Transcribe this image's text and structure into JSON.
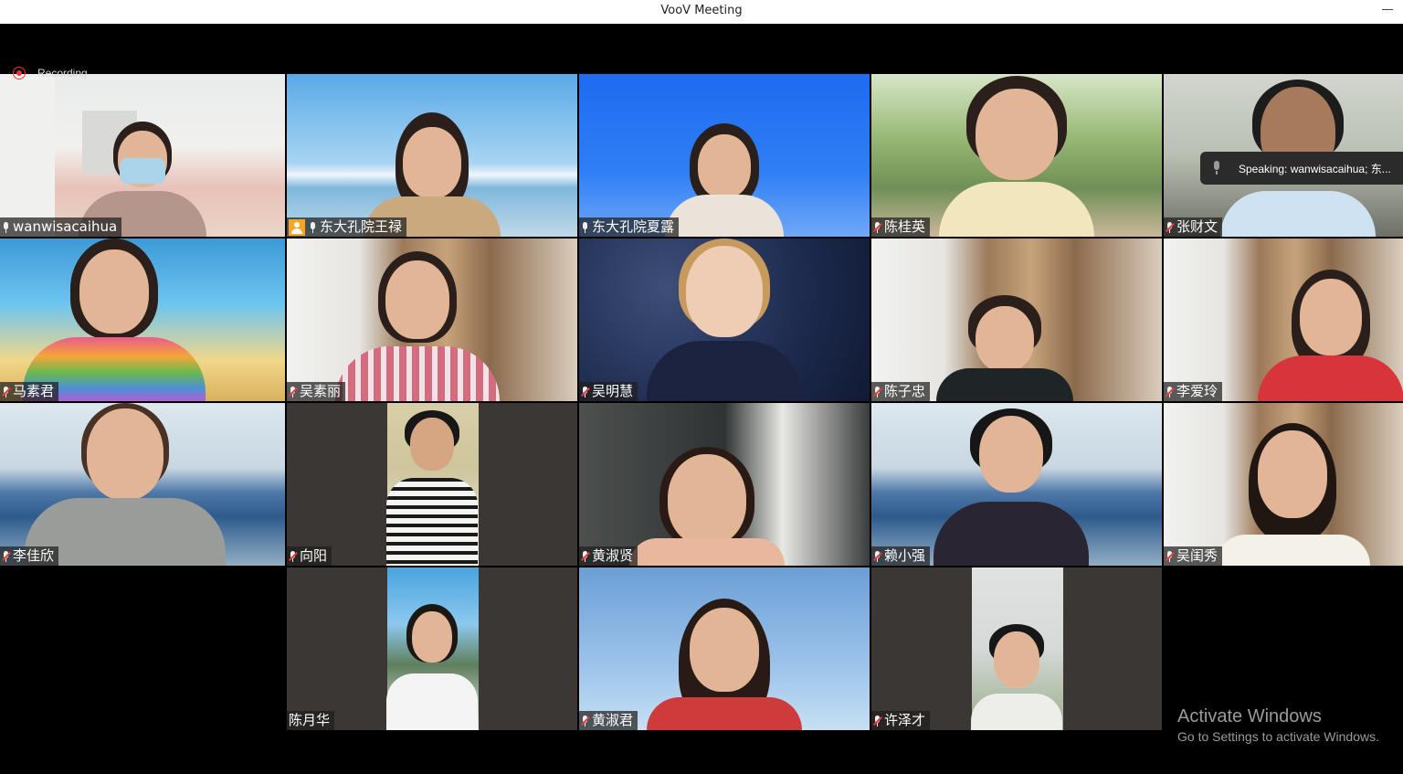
{
  "window": {
    "title": "VooV Meeting"
  },
  "recording": {
    "label": "Recording"
  },
  "speaking": {
    "label": "Speaking: wanwisacaihua; 东..."
  },
  "participants": [
    {
      "name": "wanwisacaihua",
      "mic": "on"
    },
    {
      "name": "东大孔院王禄",
      "mic": "on",
      "host": true
    },
    {
      "name": "东大孔院夏露",
      "mic": "on"
    },
    {
      "name": "陈桂英",
      "mic": "muted"
    },
    {
      "name": "张财文",
      "mic": "muted"
    },
    {
      "name": "马素君",
      "mic": "muted"
    },
    {
      "name": "吴素丽",
      "mic": "muted"
    },
    {
      "name": "吴明慧",
      "mic": "muted"
    },
    {
      "name": "陈子忠",
      "mic": "muted"
    },
    {
      "name": "李爱玲",
      "mic": "muted"
    },
    {
      "name": "李佳欣",
      "mic": "muted"
    },
    {
      "name": "向阳",
      "mic": "muted"
    },
    {
      "name": "黄淑贤",
      "mic": "muted"
    },
    {
      "name": "赖小强",
      "mic": "muted"
    },
    {
      "name": "吴闺秀",
      "mic": "muted"
    },
    {
      "name": "陈月华",
      "mic": "none"
    },
    {
      "name": "黄淑君",
      "mic": "muted"
    },
    {
      "name": "许泽才",
      "mic": "muted"
    }
  ],
  "activation": {
    "title": "Activate Windows",
    "subtitle": "Go to Settings to activate Windows."
  },
  "colors": {
    "active_speaker_border": "#3ecf63",
    "host_badge": "#f5a623",
    "muted_slash": "#e33d3d"
  }
}
